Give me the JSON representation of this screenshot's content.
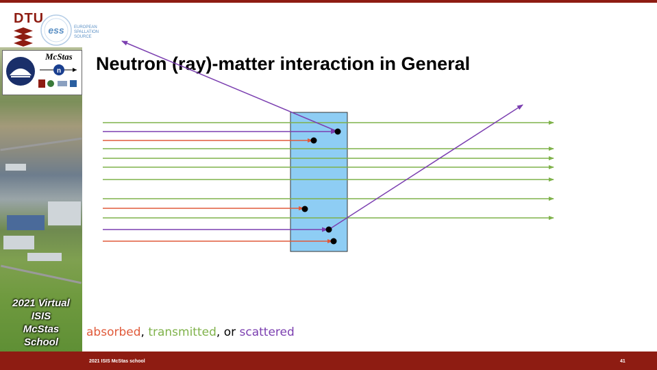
{
  "title": "Neutron (ray)-matter interaction in General",
  "legend": {
    "absorbed": "absorbed",
    "sep1": ", ",
    "transmitted": "transmitted",
    "sep2": ", or ",
    "scattered": "scattered"
  },
  "footer": {
    "left": "2021 ISIS McStas school",
    "page": "41"
  },
  "sidebar": {
    "lines": [
      "2021 Virtual",
      "ISIS",
      "McStas",
      "School"
    ]
  },
  "logos": {
    "dtu": "DTU",
    "ess_lines": [
      "EUROPEAN",
      "SPALLATION",
      "SOURCE"
    ],
    "ess_mark": "ess",
    "mcstas": "McStas",
    "mcstas_n": "n"
  },
  "colors": {
    "absorbed": "#e05a3a",
    "transmitted": "#7fb24a",
    "scattered": "#7b3fb0",
    "sample": "#8ecdf4",
    "brand": "#8e1c12"
  }
}
